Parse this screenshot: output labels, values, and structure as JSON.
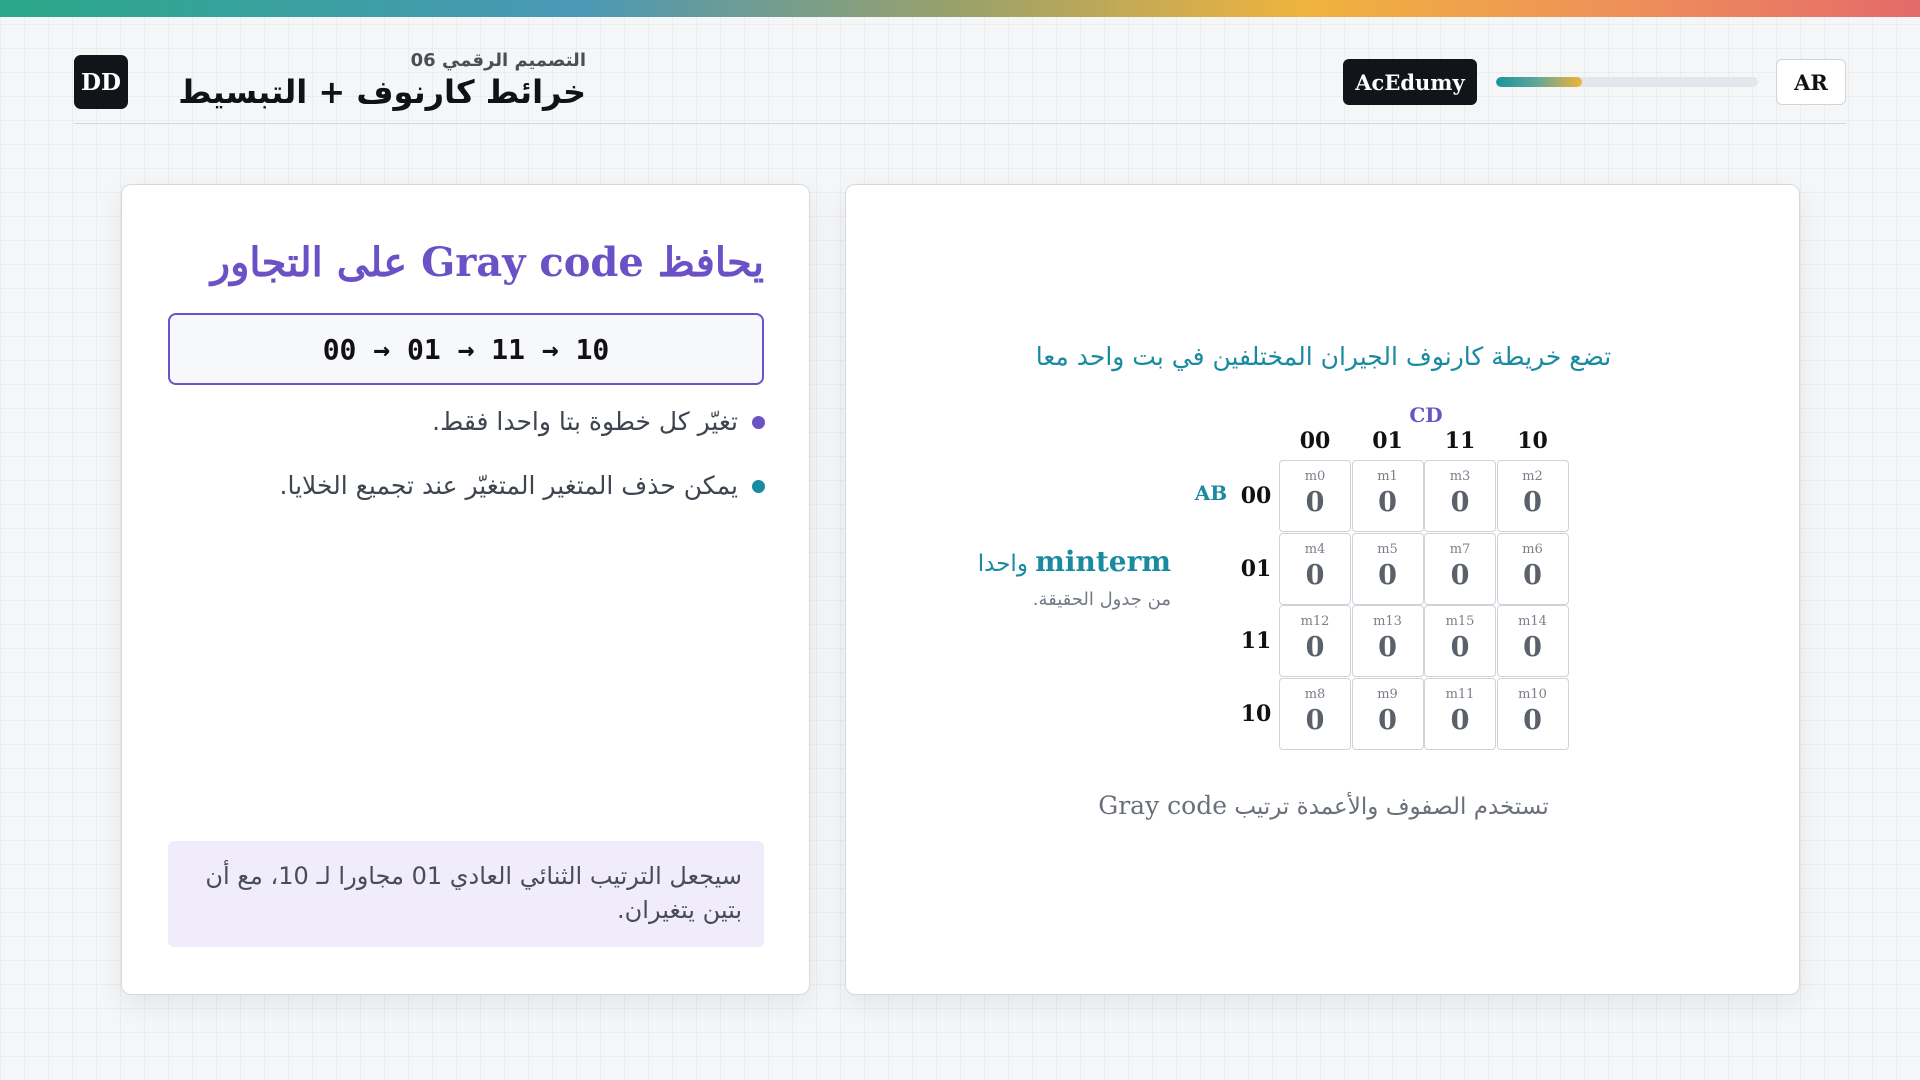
{
  "header": {
    "logo": "DD",
    "subtitle": "التصميم الرقمي 06",
    "title": "خرائط كارنوف + التبسيط",
    "brand": "AcEdumy",
    "progress": 0.33,
    "lang_button": "AR"
  },
  "left_card": {
    "heading": "يحافظ Gray code على التجاور",
    "sequence": "00 → 01 → 11 → 10",
    "bullets": [
      {
        "text": "تغيّر كل خطوة بتا واحدا فقط.",
        "color": "#6b53c7"
      },
      {
        "text": "يمكن حذف المتغير المتغيّر عند تجميع الخلايا.",
        "color": "#1a8aa0"
      }
    ],
    "note": "سيجعل الترتيب الثنائي العادي 01 مجاورا لـ 10، مع أن بتين يتغيران."
  },
  "right_card": {
    "heading": "تضع خريطة كارنوف الجيران المختلفين في بت واحد معا",
    "minterm_word": "minterm",
    "minterm_suffix": "واحدا",
    "minterm_sub": "من جدول الحقيقة.",
    "var_columns": "CD",
    "var_rows": "AB",
    "col_headers": [
      "00",
      "01",
      "11",
      "10"
    ],
    "row_headers": [
      "00",
      "01",
      "11",
      "10"
    ],
    "cells": [
      [
        {
          "label": "m0",
          "value": "0"
        },
        {
          "label": "m1",
          "value": "0"
        },
        {
          "label": "m3",
          "value": "0"
        },
        {
          "label": "m2",
          "value": "0"
        }
      ],
      [
        {
          "label": "m4",
          "value": "0"
        },
        {
          "label": "m5",
          "value": "0"
        },
        {
          "label": "m7",
          "value": "0"
        },
        {
          "label": "m6",
          "value": "0"
        }
      ],
      [
        {
          "label": "m12",
          "value": "0"
        },
        {
          "label": "m13",
          "value": "0"
        },
        {
          "label": "m15",
          "value": "0"
        },
        {
          "label": "m14",
          "value": "0"
        }
      ],
      [
        {
          "label": "m8",
          "value": "0"
        },
        {
          "label": "m9",
          "value": "0"
        },
        {
          "label": "m11",
          "value": "0"
        },
        {
          "label": "m10",
          "value": "0"
        }
      ]
    ],
    "caption_ar": "تستخدم الصفوف والأعمدة ترتيب",
    "caption_en": "Gray code"
  }
}
